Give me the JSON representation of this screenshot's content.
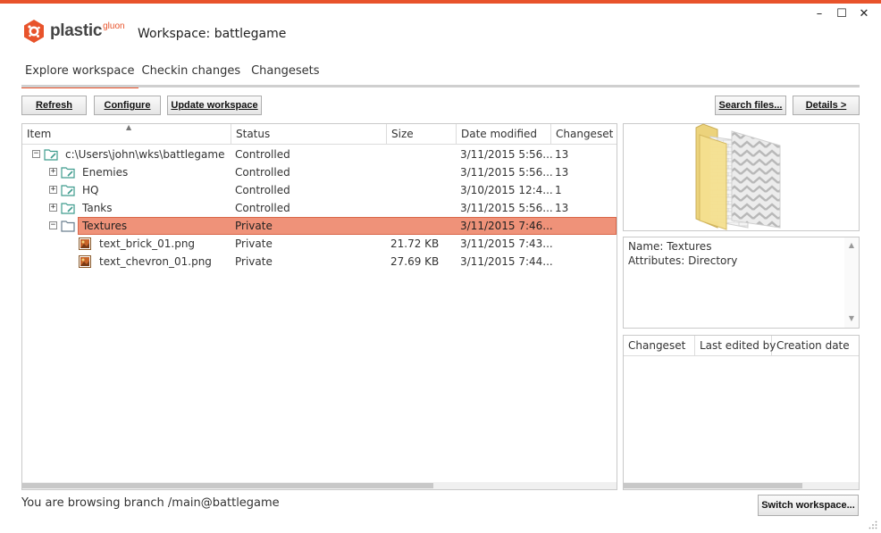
{
  "app": {
    "brand": "plastic",
    "brand_sub": "gluon",
    "workspace_title": "Workspace: battlegame",
    "accent": "#e8532b"
  },
  "window_controls": {
    "minimize": "–",
    "maximize": "☐",
    "close": "✕"
  },
  "tabs": [
    {
      "label": "Explore workspace",
      "active": true
    },
    {
      "label": "Checkin changes",
      "active": false
    },
    {
      "label": "Changesets",
      "active": false
    }
  ],
  "toolbar": {
    "refresh": "Refresh",
    "configure": "Configure",
    "update": "Update workspace",
    "search": "Search files...",
    "details": "Details >"
  },
  "table": {
    "columns": [
      "Item",
      "Status",
      "Size",
      "Date modified",
      "Changeset"
    ],
    "rows": [
      {
        "name": "c:\\Users\\john\\wks\\battlegame",
        "status": "Controlled",
        "size": "",
        "date": "3/11/2015 5:56...",
        "changeset": "13",
        "expander": "−",
        "icon": "folder-controlled-icon",
        "selected": false
      },
      {
        "name": "Enemies",
        "status": "Controlled",
        "size": "",
        "date": "3/11/2015 5:56...",
        "changeset": "13",
        "expander": "+",
        "icon": "folder-controlled-icon",
        "selected": false
      },
      {
        "name": "HQ",
        "status": "Controlled",
        "size": "",
        "date": "3/10/2015 12:4...",
        "changeset": "1",
        "expander": "+",
        "icon": "folder-controlled-icon",
        "selected": false
      },
      {
        "name": "Tanks",
        "status": "Controlled",
        "size": "",
        "date": "3/11/2015 5:56...",
        "changeset": "13",
        "expander": "+",
        "icon": "folder-controlled-icon",
        "selected": false
      },
      {
        "name": "Textures",
        "status": "Private",
        "size": "",
        "date": "3/11/2015 7:46...",
        "changeset": "",
        "expander": "−",
        "icon": "folder-private-icon",
        "selected": true
      },
      {
        "name": "text_brick_01.png",
        "status": "Private",
        "size": "21.72 KB",
        "date": "3/11/2015 7:43...",
        "changeset": "",
        "expander": "",
        "icon": "image-file-icon",
        "selected": false
      },
      {
        "name": "text_chevron_01.png",
        "status": "Private",
        "size": "27.69 KB",
        "date": "3/11/2015 7:44...",
        "changeset": "",
        "expander": "",
        "icon": "image-file-icon",
        "selected": false
      }
    ]
  },
  "properties": {
    "name_line": "Name: Textures",
    "attributes_line": "Attributes: Directory"
  },
  "history": {
    "columns": [
      "Changeset",
      "Last edited by",
      "Creation date"
    ]
  },
  "status_bar": {
    "branch_text": "You are browsing branch /main@battlegame",
    "switch_button": "Switch workspace..."
  }
}
